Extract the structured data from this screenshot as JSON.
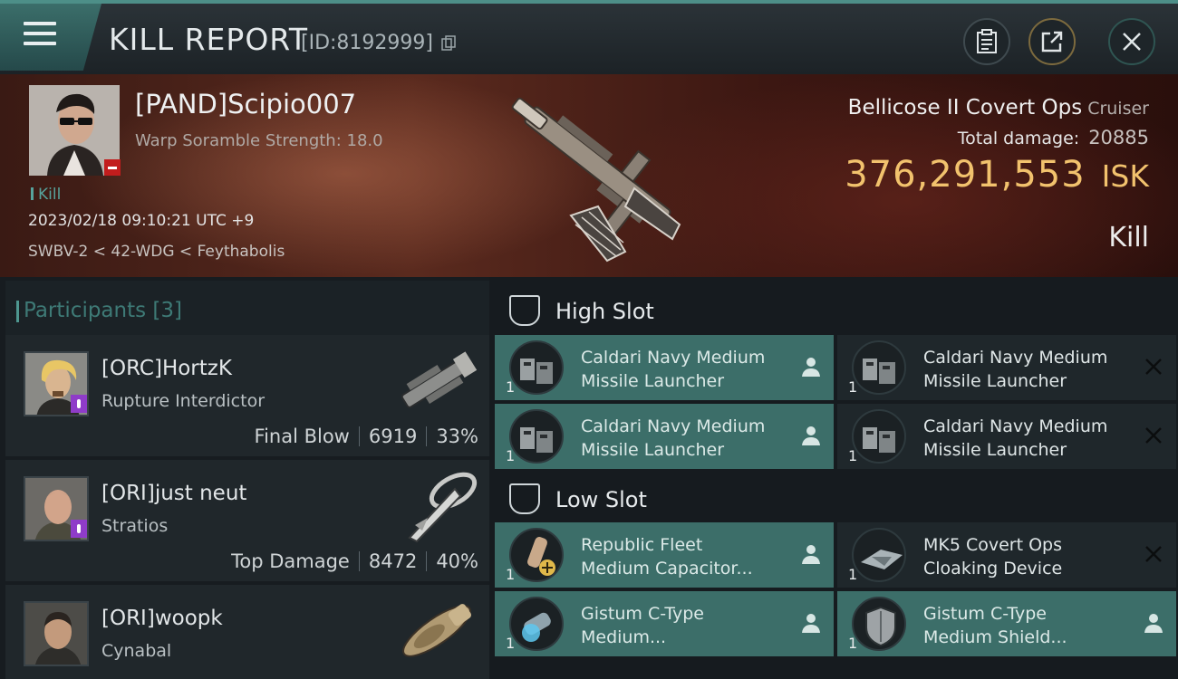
{
  "header": {
    "title": "KILL REPORT",
    "report_id": "[ID:8192999]"
  },
  "victim": {
    "name": "[PAND]Scipio007",
    "detail": "Warp Soramble Strength: 18.0",
    "tag": "Kill",
    "datetime": "2023/02/18 09:10:21 UTC +9",
    "location": "SWBV-2 < 42-WDG < Feythabolis",
    "ship_name": "Bellicose II Covert Ops",
    "ship_class": "Cruiser",
    "damage_label": "Total damage:",
    "damage_value": "20885",
    "isk_value": "376,291,553",
    "isk_unit": "ISK",
    "result": "Kill"
  },
  "participants": {
    "title": "Participants [3]",
    "rows": [
      {
        "name": "[ORC]HortzK",
        "ship": "Rupture Interdictor",
        "role": "Final Blow",
        "damage": "6919",
        "percent": "33%"
      },
      {
        "name": "[ORI]just neut",
        "ship": "Stratios",
        "role": "Top Damage",
        "damage": "8472",
        "percent": "40%"
      },
      {
        "name": "[ORI]woopk",
        "ship": "Cynabal",
        "role": "",
        "damage": "",
        "percent": ""
      }
    ]
  },
  "slots": {
    "high": {
      "label": "High Slot",
      "modules": [
        {
          "line1": "Caldari Navy Medium",
          "line2": "Missile Launcher",
          "qty": "1",
          "state": "dropped"
        },
        {
          "line1": "Caldari Navy Medium",
          "line2": "Missile Launcher",
          "qty": "1",
          "state": "destroyed"
        },
        {
          "line1": "Caldari Navy Medium",
          "line2": "Missile Launcher",
          "qty": "1",
          "state": "dropped"
        },
        {
          "line1": "Caldari Navy Medium",
          "line2": "Missile Launcher",
          "qty": "1",
          "state": "destroyed"
        }
      ]
    },
    "low": {
      "label": "Low Slot",
      "modules": [
        {
          "line1": "Republic Fleet",
          "line2": "Medium Capacitor...",
          "qty": "1",
          "state": "dropped"
        },
        {
          "line1": "MK5 Covert Ops",
          "line2": "Cloaking Device",
          "qty": "1",
          "state": "destroyed"
        },
        {
          "line1": "Gistum C-Type",
          "line2": "Medium...",
          "qty": "1",
          "state": "dropped"
        },
        {
          "line1": "Gistum C-Type",
          "line2": "Medium Shield...",
          "qty": "1",
          "state": "dropped"
        }
      ]
    }
  },
  "colors": {
    "accent_teal": "#4d8f88",
    "isk_gold": "#f2c26d",
    "dropped_bg": "#3c6e69",
    "destroyed_bg": "#1f272b"
  },
  "icons": {
    "menu": "hamburger-icon",
    "copy": "copy-icon",
    "clipboard": "clipboard-icon",
    "share": "share-icon",
    "close": "close-icon",
    "slot": "slot-shield-icon",
    "owner": "person-icon",
    "destroyed": "x-icon"
  }
}
